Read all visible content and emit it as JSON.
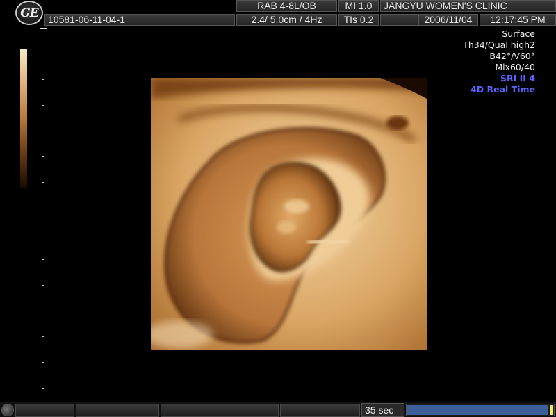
{
  "header": {
    "logo": "GE",
    "probe": "RAB 4-8L/OB",
    "mi": "MI  1.0",
    "clinic": "JANGYU WOMEN'S CLINIC",
    "patient_id": "10581-06-11-04-1",
    "depth_freq": "2.4/ 5.0cm /  4Hz",
    "tis": "TIs  0.2",
    "date": "2006/11/04",
    "time": "12:17:45 PM"
  },
  "params": {
    "lines": [
      {
        "text": "Surface",
        "style": "normal"
      },
      {
        "text": "Th34/Qual high2",
        "style": "normal"
      },
      {
        "text": "B42°/V60°",
        "style": "normal"
      },
      {
        "text": "Mix60/40",
        "style": "normal"
      },
      {
        "text": "SRI II 4",
        "style": "highlight"
      },
      {
        "text": "4D Real Time",
        "style": "highlight"
      }
    ],
    "highlight_color": "#5a64ff"
  },
  "footer": {
    "timer": "35 sec",
    "progress_fraction": 0.985
  },
  "image": {
    "icon": "ultrasound-3d-render",
    "palette": [
      "#fbe7c6",
      "#e0b07a",
      "#b8793a",
      "#6a3c14"
    ]
  }
}
